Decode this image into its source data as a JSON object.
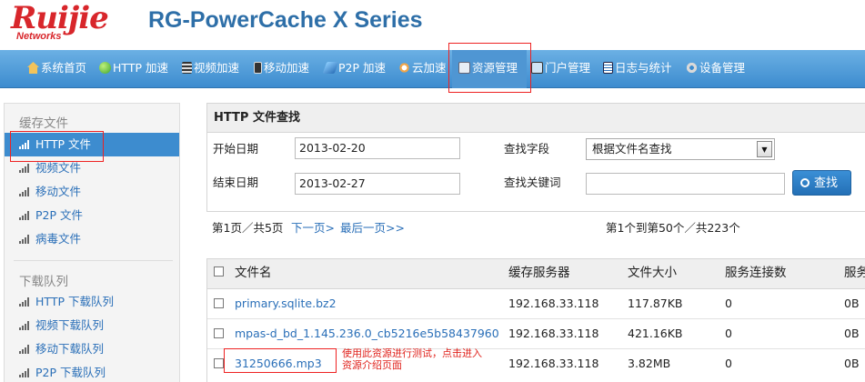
{
  "brand": {
    "logo_text": "Ruijie",
    "logo_sub": "Networks",
    "product": "RG-PowerCache X Series"
  },
  "nav": {
    "items": [
      {
        "label": "系统首页",
        "icon": "home-icon"
      },
      {
        "label": "HTTP 加速",
        "icon": "globe-icon"
      },
      {
        "label": "视频加速",
        "icon": "film-icon"
      },
      {
        "label": "移动加速",
        "icon": "phone-icon"
      },
      {
        "label": "P2P 加速",
        "icon": "p2p-icon"
      },
      {
        "label": "云加速",
        "icon": "cloud-icon"
      },
      {
        "label": "资源管理",
        "icon": "resource-icon"
      },
      {
        "label": "门户管理",
        "icon": "monitor-icon"
      },
      {
        "label": "日志与统计",
        "icon": "log-icon"
      },
      {
        "label": "设备管理",
        "icon": "gear-icon"
      }
    ],
    "active_index": 6
  },
  "sidebar": {
    "cache_title": "缓存文件",
    "cache_items": [
      "HTTP 文件",
      "视频文件",
      "移动文件",
      "P2P 文件",
      "病毒文件"
    ],
    "queue_title": "下载队列",
    "queue_items": [
      "HTTP 下载队列",
      "视频下载队列",
      "移动下载队列",
      "P2P 下载队列"
    ],
    "active_item": "HTTP 文件"
  },
  "search": {
    "title": "HTTP 文件查找",
    "start_label": "开始日期",
    "start_value": "2013-02-20",
    "end_label": "结束日期",
    "end_value": "2013-02-27",
    "field_label": "查找字段",
    "field_value": "根据文件名查找",
    "keyword_label": "查找关键词",
    "keyword_value": "",
    "button": "查找"
  },
  "pager": {
    "page_info": "第1页／共5页",
    "next": "下一页>",
    "last": "最后一页>>",
    "range_info": "第1个到第50个／共223个"
  },
  "table": {
    "headers": [
      "文件名",
      "缓存服务器",
      "文件大小",
      "服务连接数",
      "服务"
    ],
    "rows": [
      [
        "primary.sqlite.bz2",
        "192.168.33.118",
        "117.87KB",
        "0",
        "0B"
      ],
      [
        "mpas-d_bd_1.145.236.0_cb5216e5b58437960...",
        "192.168.33.118",
        "421.16KB",
        "0",
        "0B"
      ],
      [
        "31250666.mp3",
        "192.168.33.118",
        "3.82MB",
        "0",
        "0B"
      ]
    ]
  },
  "annotation": {
    "note": "使用此资源进行测试，点击进入资源介绍页面"
  },
  "colors": {
    "brand_red": "#d8262b",
    "nav_blue": "#3d8ccf",
    "link_blue": "#2a6fb8",
    "annotation_red": "#e0221c"
  }
}
